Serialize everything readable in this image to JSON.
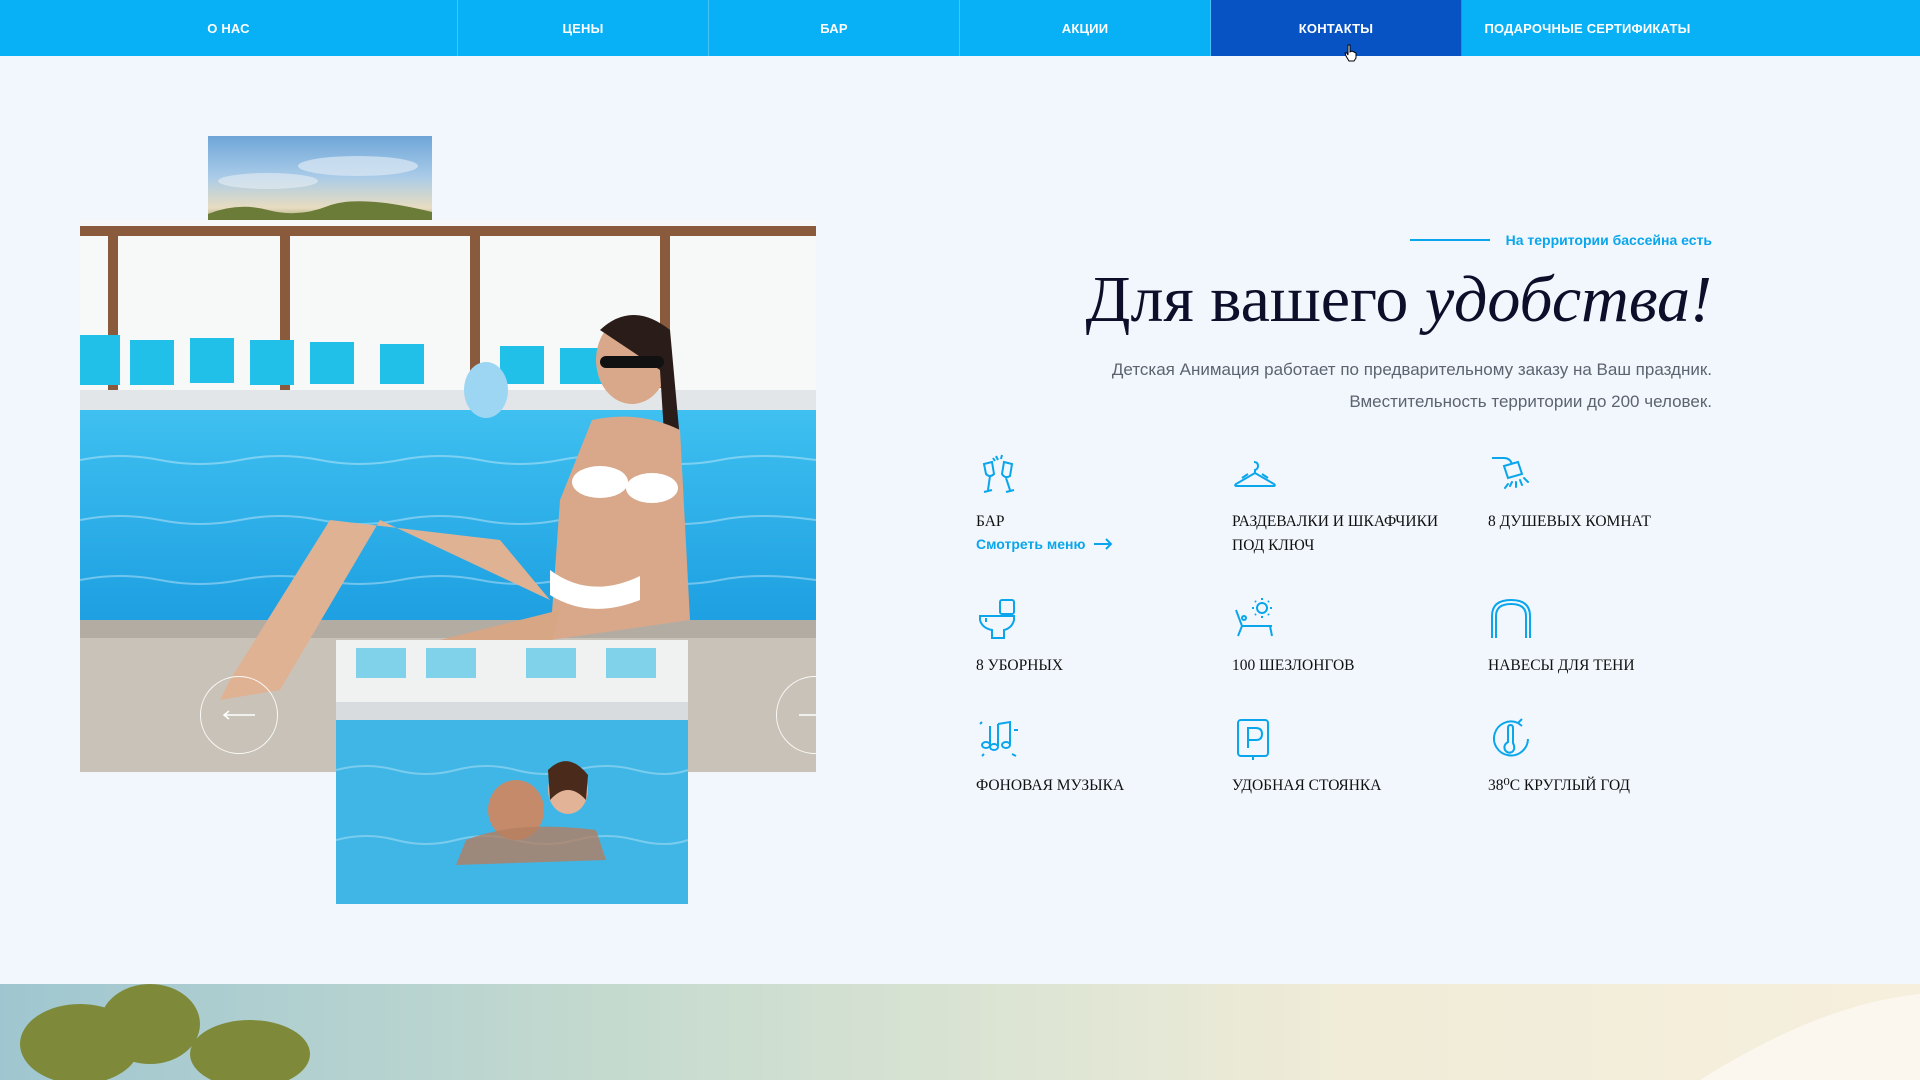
{
  "nav": {
    "items": [
      {
        "label": "О НАС"
      },
      {
        "label": "ЦЕНЫ"
      },
      {
        "label": "БАР"
      },
      {
        "label": "АКЦИИ"
      },
      {
        "label": "КОНТАКТЫ",
        "active": true
      },
      {
        "label": "ПОДАРОЧНЫЕ СЕРТИФИКАТЫ"
      }
    ]
  },
  "section": {
    "eyebrow": "На территории бассейна есть",
    "headline_regular": "Для вашего ",
    "headline_italic": "удобства!",
    "desc_line1": "Детская Анимация работает по предварительному заказу на Ваш праздник.",
    "desc_line2": "Вместительность территории до 200 человек."
  },
  "features": [
    {
      "icon": "champagne-glasses-icon",
      "label": "БАР",
      "link": "Смотреть меню"
    },
    {
      "icon": "hanger-icon",
      "label": "РАЗДЕВАЛКИ И ШКАФЧИКИ ПОД КЛЮЧ"
    },
    {
      "icon": "shower-icon",
      "label": "8 ДУШЕВЫХ КОМНАТ"
    },
    {
      "icon": "toilet-icon",
      "label": "8 УБОРНЫХ"
    },
    {
      "icon": "sunbed-icon",
      "label": "100 ШЕЗЛОНГОВ"
    },
    {
      "icon": "canopy-arch-icon",
      "label": "НАВЕСЫ ДЛЯ ТЕНИ"
    },
    {
      "icon": "music-notes-icon",
      "label": "ФОНОВАЯ МУЗЫКА"
    },
    {
      "icon": "parking-icon",
      "label": "УДОБНАЯ СТОЯНКА"
    },
    {
      "icon": "thermometer-icon",
      "label": "38⁰С КРУГЛЫЙ ГОД"
    }
  ],
  "colors": {
    "nav_bg": "#08b0f5",
    "nav_active": "#0853c4",
    "accent": "#0aa6ec",
    "page_bg": "#f1f7fd"
  }
}
